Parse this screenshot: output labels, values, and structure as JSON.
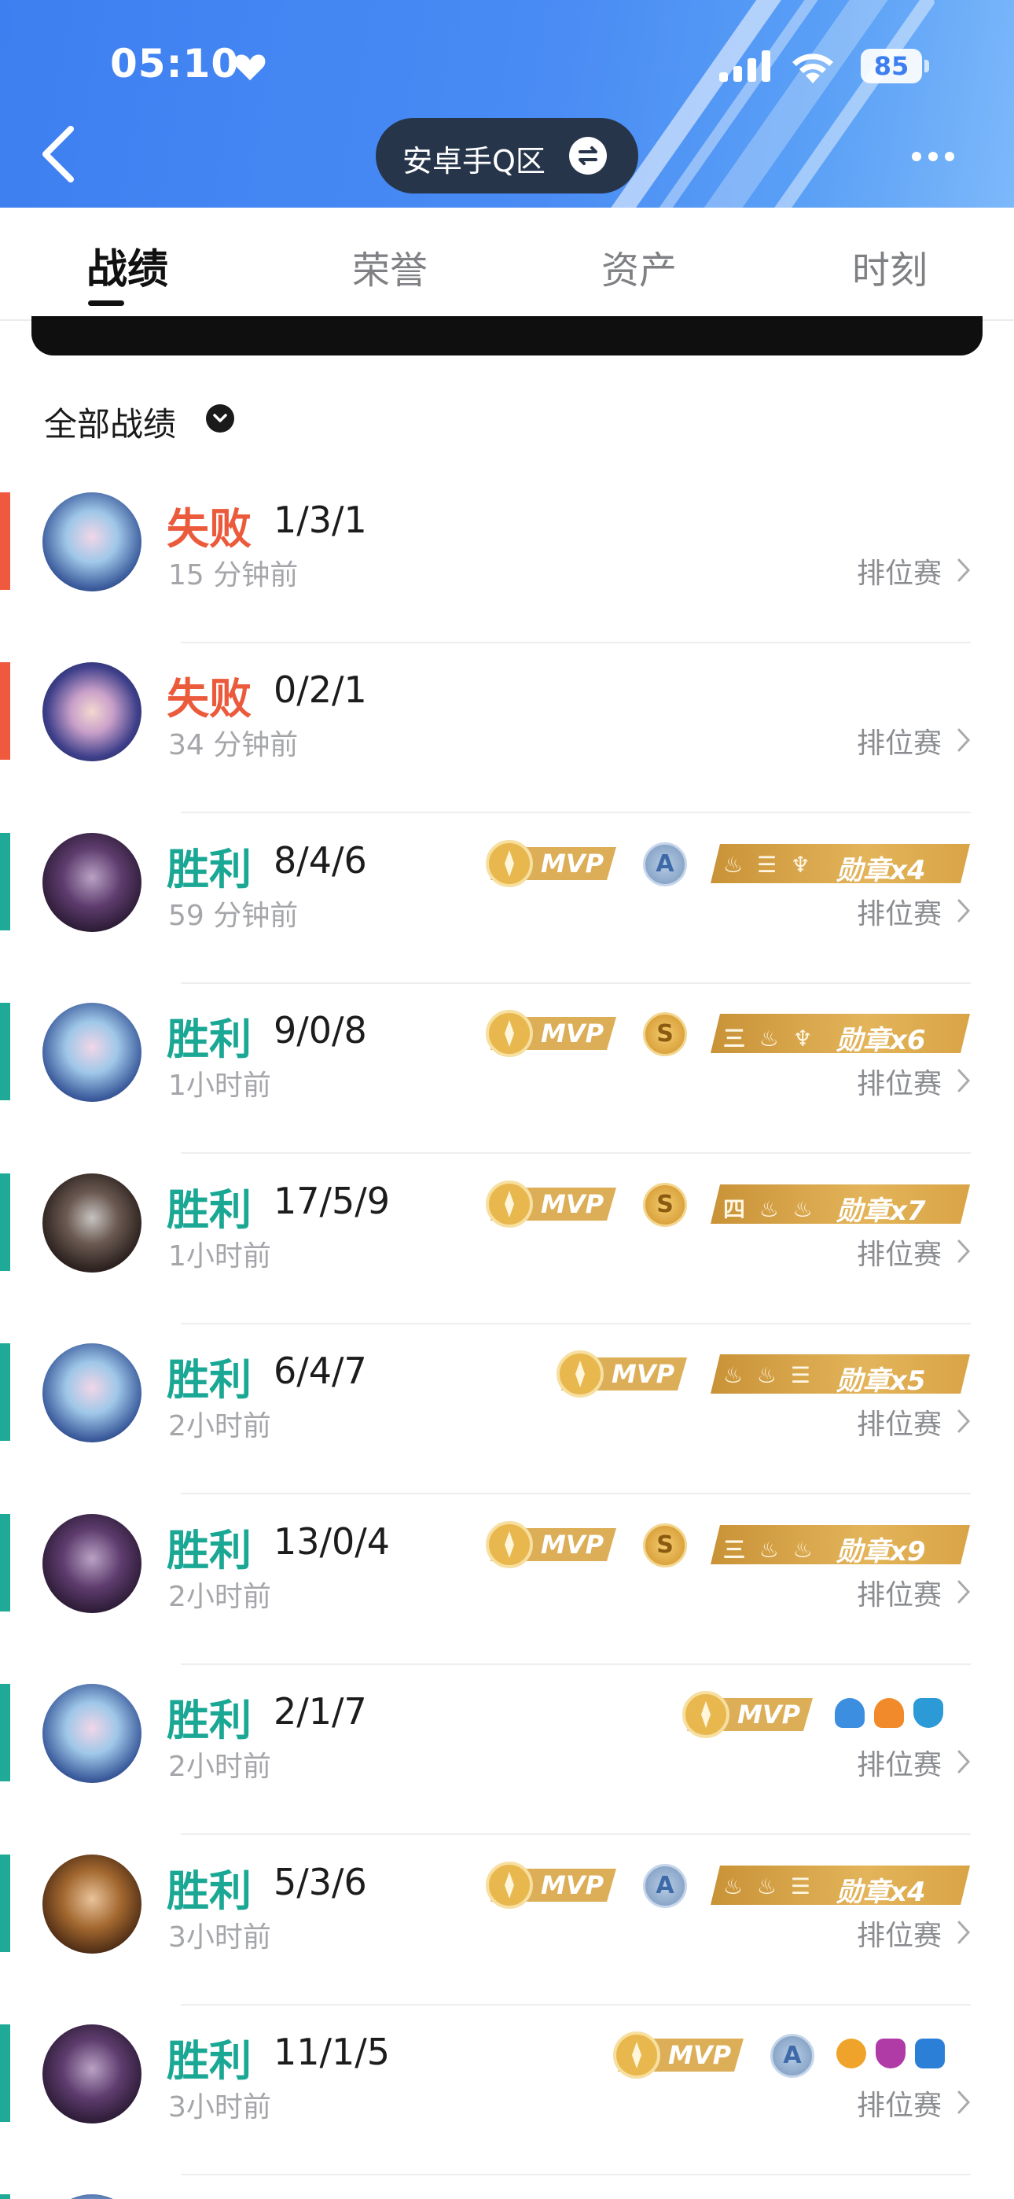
{
  "status_bar": {
    "time": "05:10",
    "battery": "85"
  },
  "nav": {
    "region": "安卓手Q区"
  },
  "tabs": [
    {
      "label": "战绩",
      "active": true
    },
    {
      "label": "荣誉",
      "active": false
    },
    {
      "label": "资产",
      "active": false
    },
    {
      "label": "时刻",
      "active": false
    }
  ],
  "filter": {
    "label": "全部战绩"
  },
  "matches": [
    {
      "result": "失败",
      "kda": "1/3/1",
      "time": "15 分钟前",
      "mode": "排位赛"
    },
    {
      "result": "失败",
      "kda": "0/2/1",
      "time": "34 分钟前",
      "mode": "排位赛"
    },
    {
      "result": "胜利",
      "kda": "8/4/6",
      "time": "59 分钟前",
      "mode": "排位赛",
      "mvp": "MVP",
      "grade": "A",
      "medal": "勋章x4"
    },
    {
      "result": "胜利",
      "kda": "9/0/8",
      "time": "1小时前",
      "mode": "排位赛",
      "mvp": "MVP",
      "grade": "S",
      "medal": "勋章x6",
      "medal_prefix": "三"
    },
    {
      "result": "胜利",
      "kda": "17/5/9",
      "time": "1小时前",
      "mode": "排位赛",
      "mvp": "MVP",
      "grade": "S",
      "medal": "勋章x7",
      "medal_prefix": "四"
    },
    {
      "result": "胜利",
      "kda": "6/4/7",
      "time": "2小时前",
      "mode": "排位赛",
      "mvp": "MVP",
      "medal": "勋章x5"
    },
    {
      "result": "胜利",
      "kda": "13/0/4",
      "time": "2小时前",
      "mode": "排位赛",
      "mvp": "MVP",
      "grade": "S",
      "medal": "勋章x9",
      "medal_prefix": "三"
    },
    {
      "result": "胜利",
      "kda": "2/1/7",
      "time": "2小时前",
      "mode": "排位赛",
      "mvp": "MVP"
    },
    {
      "result": "胜利",
      "kda": "5/3/6",
      "time": "3小时前",
      "mode": "排位赛",
      "mvp": "MVP",
      "grade": "A",
      "medal": "勋章x4"
    },
    {
      "result": "胜利",
      "kda": "11/1/5",
      "time": "3小时前",
      "mode": "排位赛",
      "mvp": "MVP",
      "grade": "A"
    }
  ],
  "colors": {
    "loss": "#ec5a3c",
    "win": "#1aa895",
    "header": "#3d7ff0"
  }
}
